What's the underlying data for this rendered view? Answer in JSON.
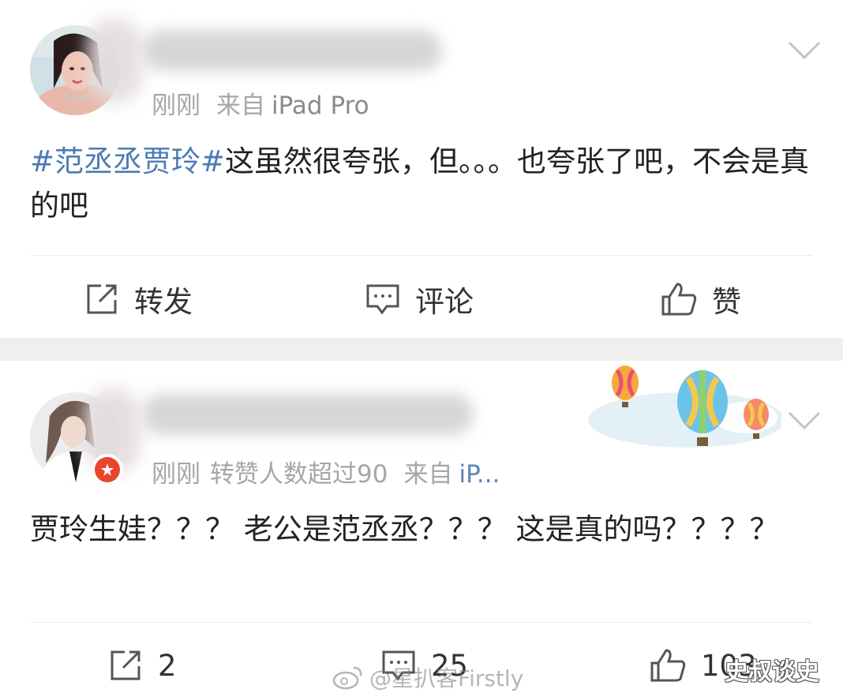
{
  "posts": [
    {
      "time": "刚刚",
      "source_prefix": "来自",
      "source": "iPad Pro",
      "topic": "#范丞丞贾玲#",
      "text_after_topic": "这虽然很夸张，但。。。也夸张了吧，不会是真的吧",
      "actions": {
        "repost": "转发",
        "comment": "评论",
        "like": "赞"
      }
    },
    {
      "time": "刚刚",
      "repost_info": "转赞人数超过90",
      "source_prefix": "来自",
      "source": "iP...",
      "text": "贾玲生娃？？？ 老公是范丞丞？？？ 这是真的吗？？？？",
      "actions": {
        "repost": "2",
        "comment": "25",
        "like": "103"
      }
    }
  ],
  "watermark": {
    "weibo": "@星扒客Firstly",
    "corner": "史叔谈史"
  },
  "colors": {
    "topic": "#4a7bb5",
    "meta": "#a6a6a6",
    "separator": "#efefef",
    "badge": "#e8452c"
  },
  "icons": [
    "chevron-down-icon",
    "repost-icon",
    "comment-icon",
    "like-icon",
    "verified-badge-icon",
    "hot-air-balloon-icon",
    "weibo-logo-icon"
  ]
}
